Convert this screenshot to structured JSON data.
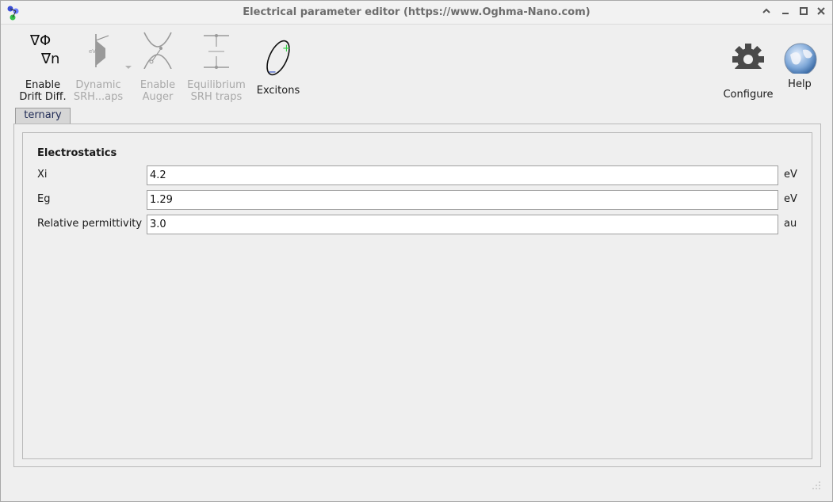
{
  "window": {
    "title": "Electrical parameter editor (https://www.Oghma-Nano.com)"
  },
  "toolbar": {
    "drift_diff": {
      "label_line1": "Enable",
      "label_line2": "Drift Diff.",
      "icon": "gradient-phi-n-icon",
      "enabled": true
    },
    "dynamic_srh": {
      "label_line1": "Dynamic",
      "label_line2": "SRH...aps",
      "icon": "srh-traps-icon",
      "enabled": false
    },
    "auger": {
      "label_line1": "Enable",
      "label_line2": "Auger",
      "icon": "auger-icon",
      "enabled": false
    },
    "equilibrium_srh": {
      "label_line1": "Equilibrium",
      "label_line2": "SRH traps",
      "icon": "equilibrium-traps-icon",
      "enabled": false
    },
    "excitons": {
      "label": "Excitons",
      "icon": "exciton-icon",
      "enabled": true
    },
    "configure": {
      "label": "Configure",
      "icon": "gear-icon"
    },
    "help": {
      "label": "Help",
      "icon": "globe-icon"
    }
  },
  "tabs": [
    {
      "label": "ternary",
      "selected": true
    }
  ],
  "section": {
    "title": "Electrostatics"
  },
  "params": [
    {
      "label": "Xi",
      "value": "4.2",
      "unit": "eV"
    },
    {
      "label": "Eg",
      "value": "1.29",
      "unit": "eV"
    },
    {
      "label": "Relative permittivity",
      "value": "3.0",
      "unit": "au"
    }
  ],
  "colors": {
    "tab_underline": "#5a6ea0",
    "exciton_plus": "#2ecc40",
    "exciton_minus": "#1f3fbf"
  }
}
